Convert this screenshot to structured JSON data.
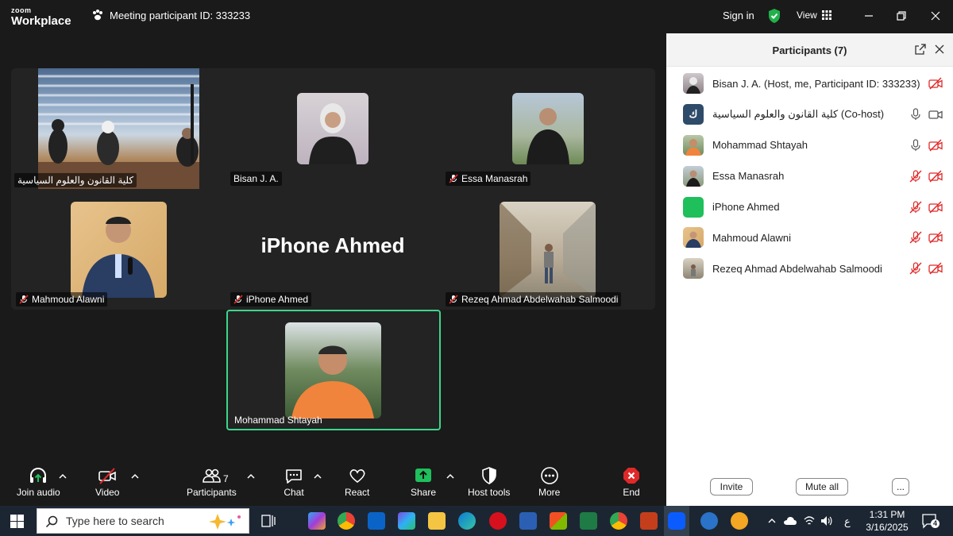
{
  "app": {
    "logo_top": "zoom",
    "logo_bottom": "Workplace",
    "meeting_label": "Meeting participant ID: 333233",
    "sign_in": "Sign in",
    "view": "View"
  },
  "gallery": {
    "tiles": [
      {
        "name": "كلية القانون والعلوم السياسية",
        "muted": false
      },
      {
        "name": "Bisan J. A.",
        "muted": false
      },
      {
        "name": "Essa Manasrah",
        "muted": true
      },
      {
        "name": "Mahmoud Alawni",
        "muted": true
      },
      {
        "name": "iPhone Ahmed",
        "muted": true,
        "big_label": "iPhone Ahmed"
      },
      {
        "name": "Rezeq Ahmad Abdelwahab Salmoodi",
        "muted": true
      }
    ],
    "active_speaker": {
      "name": "Mohammad Shtayah"
    }
  },
  "toolbar": {
    "join_audio": "Join audio",
    "video": "Video",
    "participants": "Participants",
    "participants_count": "7",
    "chat": "Chat",
    "react": "React",
    "share": "Share",
    "host_tools": "Host tools",
    "more": "More",
    "end": "End"
  },
  "panel": {
    "title": "Participants (7)",
    "participants": [
      {
        "name": "Bisan J. A. (Host, me, Participant ID: 333233)",
        "avatar": "photo"
      },
      {
        "name": "كلية القانون والعلوم السياسية (Co-host)",
        "avatar": "ك"
      },
      {
        "name": "Mohammad Shtayah",
        "avatar": "photo"
      },
      {
        "name": "Essa Manasrah",
        "avatar": "photo"
      },
      {
        "name": "iPhone Ahmed",
        "avatar": "green"
      },
      {
        "name": "Mahmoud Alawni",
        "avatar": "photo"
      },
      {
        "name": "Rezeq Ahmad Abdelwahab Salmoodi",
        "avatar": "photo"
      }
    ],
    "invite": "Invite",
    "mute_all": "Mute all",
    "more": "..."
  },
  "taskbar": {
    "search_placeholder": "Type here to search",
    "time": "1:31 PM",
    "date": "3/16/2025",
    "lang": "ع",
    "notifications": "4"
  },
  "colors": {
    "accent_green": "#3dd68c",
    "muted_red": "#e02828",
    "share_green": "#1fbf5c",
    "end_red": "#e02828"
  }
}
